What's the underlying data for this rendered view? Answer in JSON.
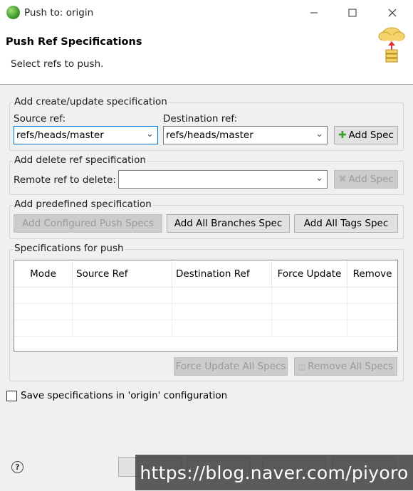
{
  "window": {
    "title": "Push to: origin"
  },
  "banner": {
    "title": "Push Ref Specifications",
    "description": "Select refs to push."
  },
  "add_update": {
    "group_label": "Add create/update specification",
    "source_label": "Source ref:",
    "source_value": "refs/heads/master",
    "dest_label": "Destination ref:",
    "dest_value": "refs/heads/master",
    "add_spec_button": "Add Spec"
  },
  "add_delete": {
    "group_label": "Add delete ref specification",
    "remote_label": "Remote ref to delete:",
    "remote_value": "",
    "add_spec_button": "Add Spec"
  },
  "predefined": {
    "group_label": "Add predefined specification",
    "configured_button": "Add Configured Push Specs",
    "branches_button": "Add All Branches Spec",
    "tags_button": "Add All Tags Spec"
  },
  "specs": {
    "group_label": "Specifications for push",
    "columns": [
      "Mode",
      "Source Ref",
      "Destination Ref",
      "Force Update",
      "Remove"
    ],
    "force_all_button": "Force Update All Specs",
    "remove_all_button": "Remove All Specs"
  },
  "save_config": {
    "label": "Save specifications in 'origin' configuration",
    "checked": false
  },
  "watermark": "https://blog.naver.com/piyoro",
  "icons": {
    "app": "eclipse-egit-icon",
    "banner": "push-cloud-icon",
    "help": "help-icon"
  }
}
